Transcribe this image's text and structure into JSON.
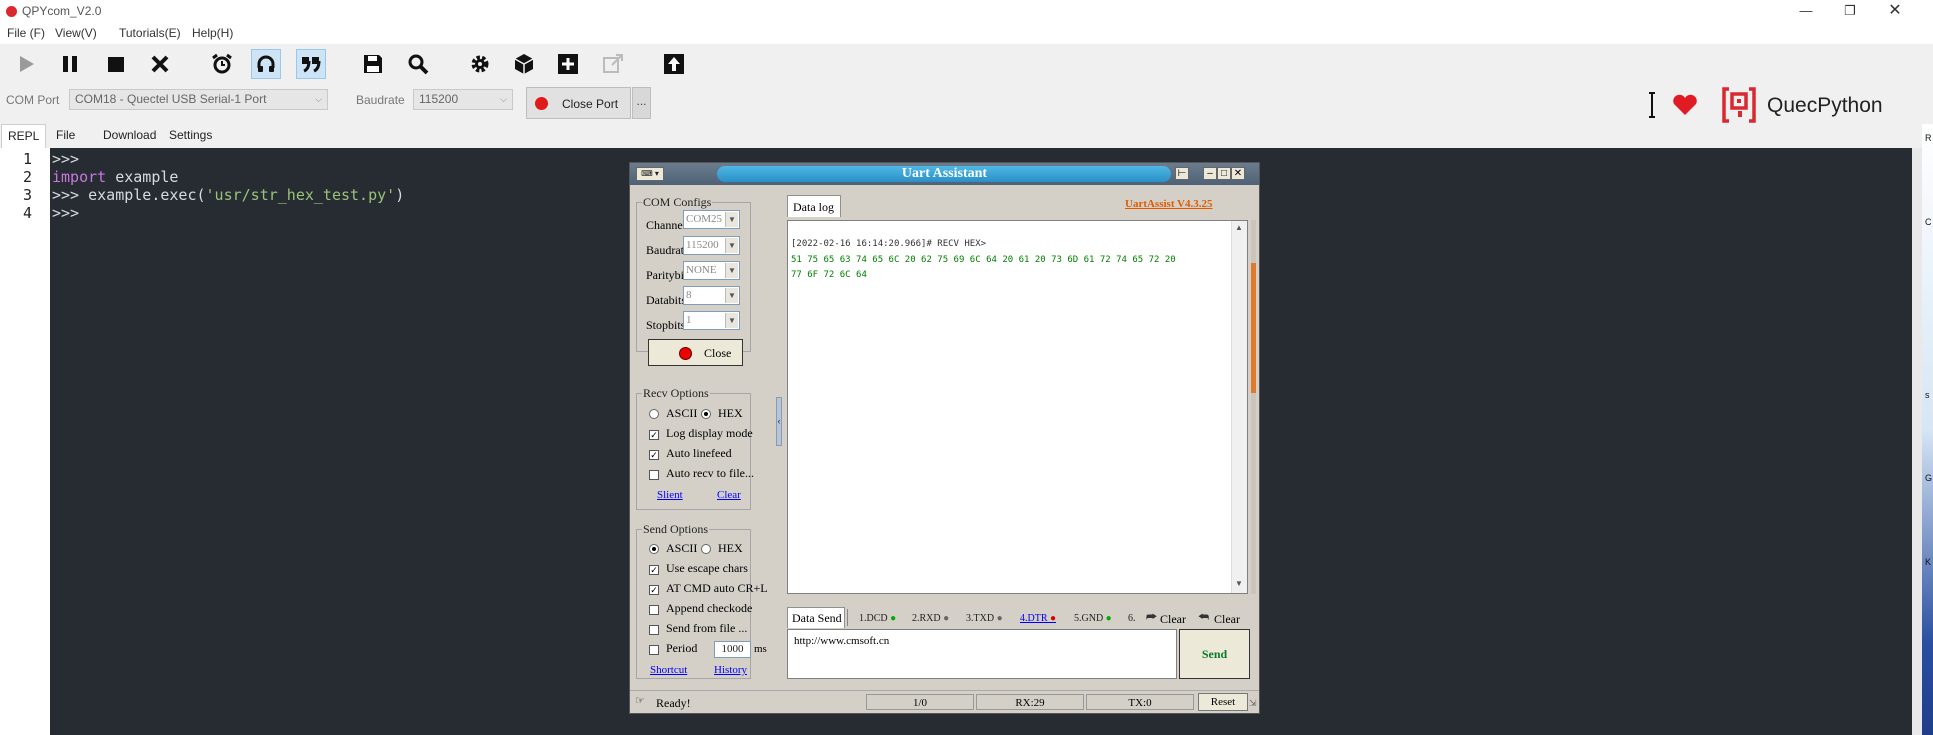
{
  "app": {
    "title": "QPYcom_V2.0"
  },
  "menu": [
    "File (F)",
    "View(V)",
    "Tutorials(E)",
    "Help(H)"
  ],
  "toolbar_icons": [
    "play-icon",
    "pause-icon",
    "stop-icon",
    "close-x-icon",
    "alarm-clock-icon",
    "headset-icon",
    "quote-icon",
    "save-icon",
    "search-icon",
    "gear-icon",
    "package-icon",
    "add-icon",
    "external-link-icon",
    "upload-arrow-icon"
  ],
  "port": {
    "com_label": "COM Port",
    "com_value": "COM18 - Quectel USB Serial-1 Port",
    "baud_label": "Baudrate",
    "baud_value": "115200",
    "close_label": "Close Port",
    "more_label": "..."
  },
  "brand": {
    "text": "QuecPython"
  },
  "tabs": [
    "REPL",
    "File",
    "Download",
    "Settings"
  ],
  "editor": {
    "line_numbers": [
      "1",
      "2",
      "3",
      "4"
    ],
    "line1": ">>>",
    "line2_kw": "import",
    "line2_rest": " example",
    "line3_pre": ">>> example.exec(",
    "line3_str": "'usr/str_hex_test.py'",
    "line3_post": ")",
    "line4": ">>>"
  },
  "right_strip_chars": [
    "R",
    "C",
    "s",
    "G",
    "K"
  ],
  "uart": {
    "title": "Uart Assistant",
    "version": "UartAssist V4.3.25",
    "com_configs": {
      "title": "COM Configs",
      "channel_label": "Channel",
      "channel_value": "COM25 #",
      "baud_label": "Baudrate",
      "baud_value": "115200",
      "parity_label": "Paritybits",
      "parity_value": "NONE",
      "databits_label": "Databits",
      "databits_value": "8",
      "stopbits_label": "Stopbits",
      "stopbits_value": "1",
      "close_label": "Close"
    },
    "recv_options": {
      "title": "Recv Options",
      "ascii": "ASCII",
      "hex": "HEX",
      "log_display": "Log display mode",
      "auto_linefeed": "Auto linefeed",
      "auto_recv_file": "Auto recv to file...",
      "slient": "Slient",
      "clear": "Clear"
    },
    "send_options": {
      "title": "Send Options",
      "ascii": "ASCII",
      "hex": "HEX",
      "escape": "Use escape chars",
      "at_cmd": "AT CMD auto CR+L",
      "append_check": "Append checkode",
      "send_file": "Send from file ...",
      "period": "Period",
      "period_value": "1000",
      "period_unit": "ms",
      "shortcut": "Shortcut",
      "history": "History"
    },
    "datalog": {
      "tab": "Data log",
      "header": "[2022-02-16 16:14:20.966]# RECV HEX>",
      "line1": "51 75 65 63 74 65 6C 20 62 75 69 6C 64 20 61 20 73 6D 61 72 74 65 72 20",
      "line2": "77 6F 72 6C 64"
    },
    "send_bar": {
      "tab": "Data Send",
      "pins": [
        "1.DCD",
        "2.RXD",
        "3.TXD",
        "4.DTR",
        "5.GND",
        "6."
      ],
      "clear1": "Clear",
      "clear2": "Clear"
    },
    "send_text": "http://www.cmsoft.cn",
    "send_button": "Send",
    "status": {
      "ready": "Ready!",
      "count": "1/0",
      "rx": "RX:29",
      "tx": "TX:0",
      "reset": "Reset"
    }
  }
}
